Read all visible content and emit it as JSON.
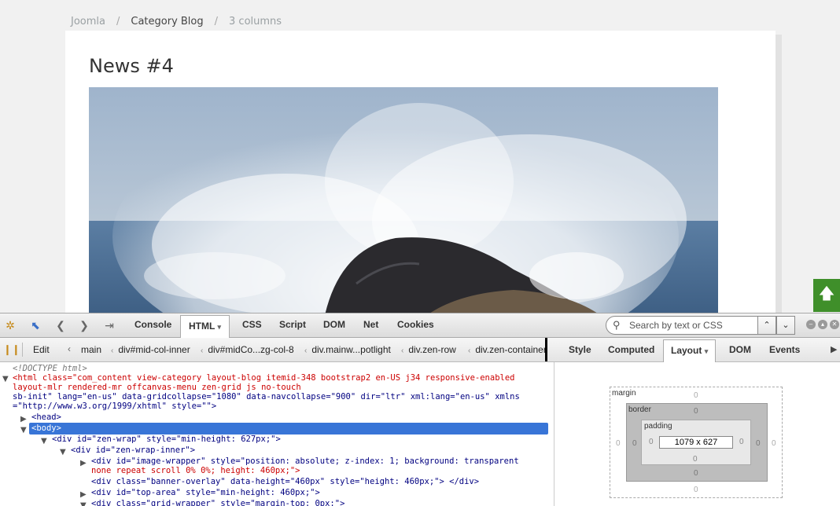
{
  "breadcrumb": [
    "Joomla",
    "Category Blog",
    "3 columns"
  ],
  "breadcrumb_sep": "/",
  "article": {
    "title": "News #4"
  },
  "to_top_icon": "arrow-up-icon",
  "devtools": {
    "main_tabs": [
      "Console",
      "HTML",
      "CSS",
      "Script",
      "DOM",
      "Net",
      "Cookies"
    ],
    "active_tab": "HTML",
    "search_placeholder": "Search by text or CSS selector",
    "edit_label": "Edit",
    "breadcrumbs": [
      "main",
      "div#mid-col-inner",
      "div#midCo...zg-col-8",
      "div.mainw...potlight",
      "div.zen-row",
      "div.zen-container"
    ],
    "side_tabs": [
      "Style",
      "Computed",
      "Layout",
      "DOM",
      "Events"
    ],
    "active_side_tab": "Layout",
    "tree": {
      "doctype": "<!DOCTYPE html>",
      "html_line1": "<html class=\"com_content view-category layout-blog itemid-348 bootstrap2 en-US j34 responsive-enabled",
      "html_line2": "layout-mlr rendered-mr offcanvas-menu zen-grid js no-touch",
      "html_line3": "sb-init\" lang=\"en-us\" data-gridcollapse=\"1080\" data-navcollapse=\"900\" dir=\"ltr\" xml:lang=\"en-us\" xmlns",
      "html_line4": "=\"http://www.w3.org/1999/xhtml\" style=\"\">",
      "head": "<head>",
      "body": "<body>",
      "zen_wrap": "<div id=\"zen-wrap\" style=\"min-height: 627px;\">",
      "zen_wrap_inner": "<div id=\"zen-wrap-inner\">",
      "image_wrapper1": "<div id=\"image-wrapper\" style=\"position: absolute; z-index: 1; background: transparent",
      "image_wrapper2": "none repeat scroll 0% 0%; height: 460px;\">",
      "banner_overlay": "<div class=\"banner-overlay\" data-height=\"460px\" style=\"height: 460px;\"> </div>",
      "top_area": "<div id=\"top-area\" style=\"min-height: 460px;\">",
      "grid_wrapper": "<div class=\"grid-wrapper\" style=\"margin-top: 0px;\">"
    },
    "box_model": {
      "margin_label": "margin",
      "border_label": "border",
      "padding_label": "padding",
      "content_size": "1079 x 627",
      "zero": "0"
    }
  }
}
